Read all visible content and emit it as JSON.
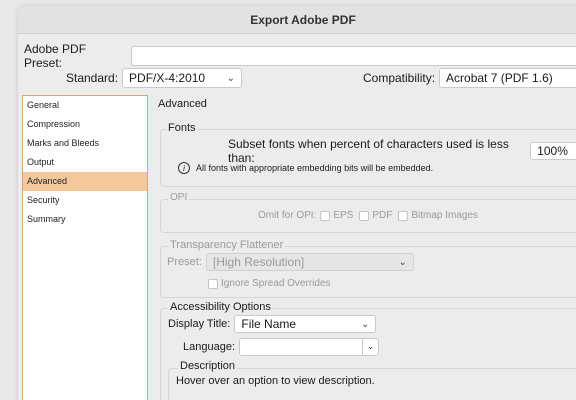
{
  "window": {
    "title": "Export Adobe PDF"
  },
  "preset": {
    "label": "Adobe PDF Preset:",
    "value": ""
  },
  "standard": {
    "label": "Standard:",
    "value": "PDF/X-4:2010"
  },
  "compatibility": {
    "label": "Compatibility:",
    "value": "Acrobat 7 (PDF 1.6)"
  },
  "sidebar": {
    "items": [
      {
        "label": "General"
      },
      {
        "label": "Compression"
      },
      {
        "label": "Marks and Bleeds"
      },
      {
        "label": "Output"
      },
      {
        "label": "Advanced"
      },
      {
        "label": "Security"
      },
      {
        "label": "Summary"
      }
    ],
    "selected_index": 4
  },
  "advanced": {
    "heading": "Advanced",
    "fonts": {
      "title": "Fonts",
      "subset_label": "Subset fonts when percent of characters used is less than:",
      "subset_value": "100%",
      "info": "All fonts with appropriate embedding bits will be embedded."
    },
    "opi": {
      "title": "OPI",
      "omit_label": "Omit for OPI:",
      "options": [
        "EPS",
        "PDF",
        "Bitmap Images"
      ]
    },
    "transparency": {
      "title": "Transparency Flattener",
      "preset_label": "Preset:",
      "preset_value": "[High Resolution]",
      "ignore_label": "Ignore Spread Overrides"
    },
    "accessibility": {
      "title": "Accessibility Options",
      "display_title_label": "Display Title:",
      "display_title_value": "File Name",
      "language_label": "Language:",
      "language_value": ""
    },
    "description": {
      "title": "Description",
      "text": "Hover over an option to view description."
    }
  }
}
